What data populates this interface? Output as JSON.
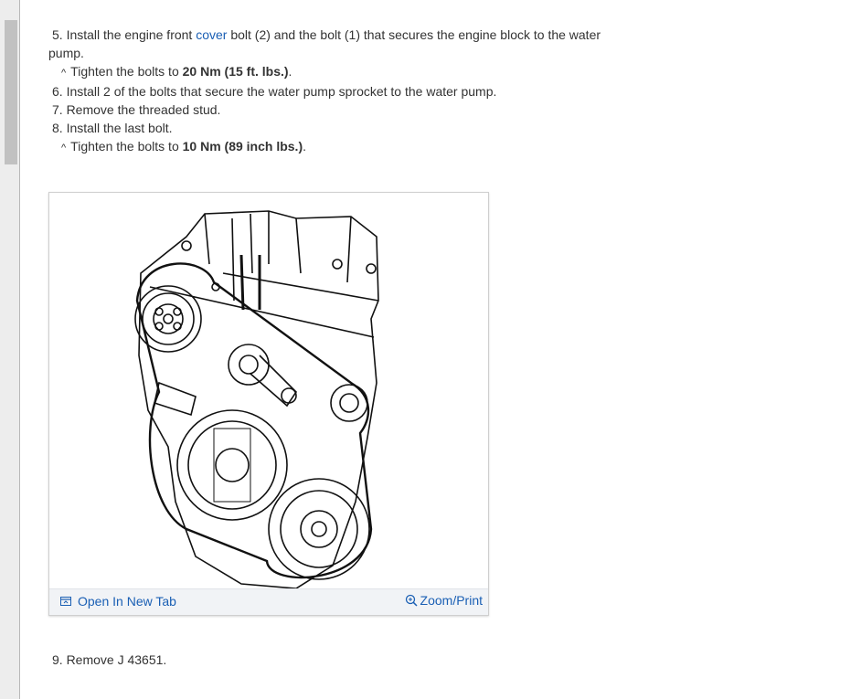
{
  "steps": {
    "s5_pre": "5. Install the engine front ",
    "s5_link": "cover",
    "s5_post": " bolt (2) and the bolt (1) that secures the engine block to the water",
    "s5_wrap": "pump.",
    "s5_sub_pre": "Tighten the bolts to ",
    "s5_sub_bold": "20 Nm (15 ft. lbs.)",
    "s5_sub_post": ".",
    "s6": "6. Install 2 of the bolts that secure the water pump sprocket to the water pump.",
    "s7": "7. Remove the threaded stud.",
    "s8": "8. Install the last bolt.",
    "s8_sub_pre": "Tighten the bolts to ",
    "s8_sub_bold": "10 Nm (89 inch lbs.)",
    "s8_sub_post": ".",
    "s9": "9. Remove J 43651."
  },
  "caret": "^",
  "figure": {
    "open_label": "Open In New Tab",
    "zoom_label": "Zoom/Print",
    "open_icon": "external-tab-icon",
    "zoom_icon": "zoom-in-icon"
  },
  "colors": {
    "link": "#1a5fb4",
    "text": "#333333",
    "bar": "#f1f3f6"
  }
}
